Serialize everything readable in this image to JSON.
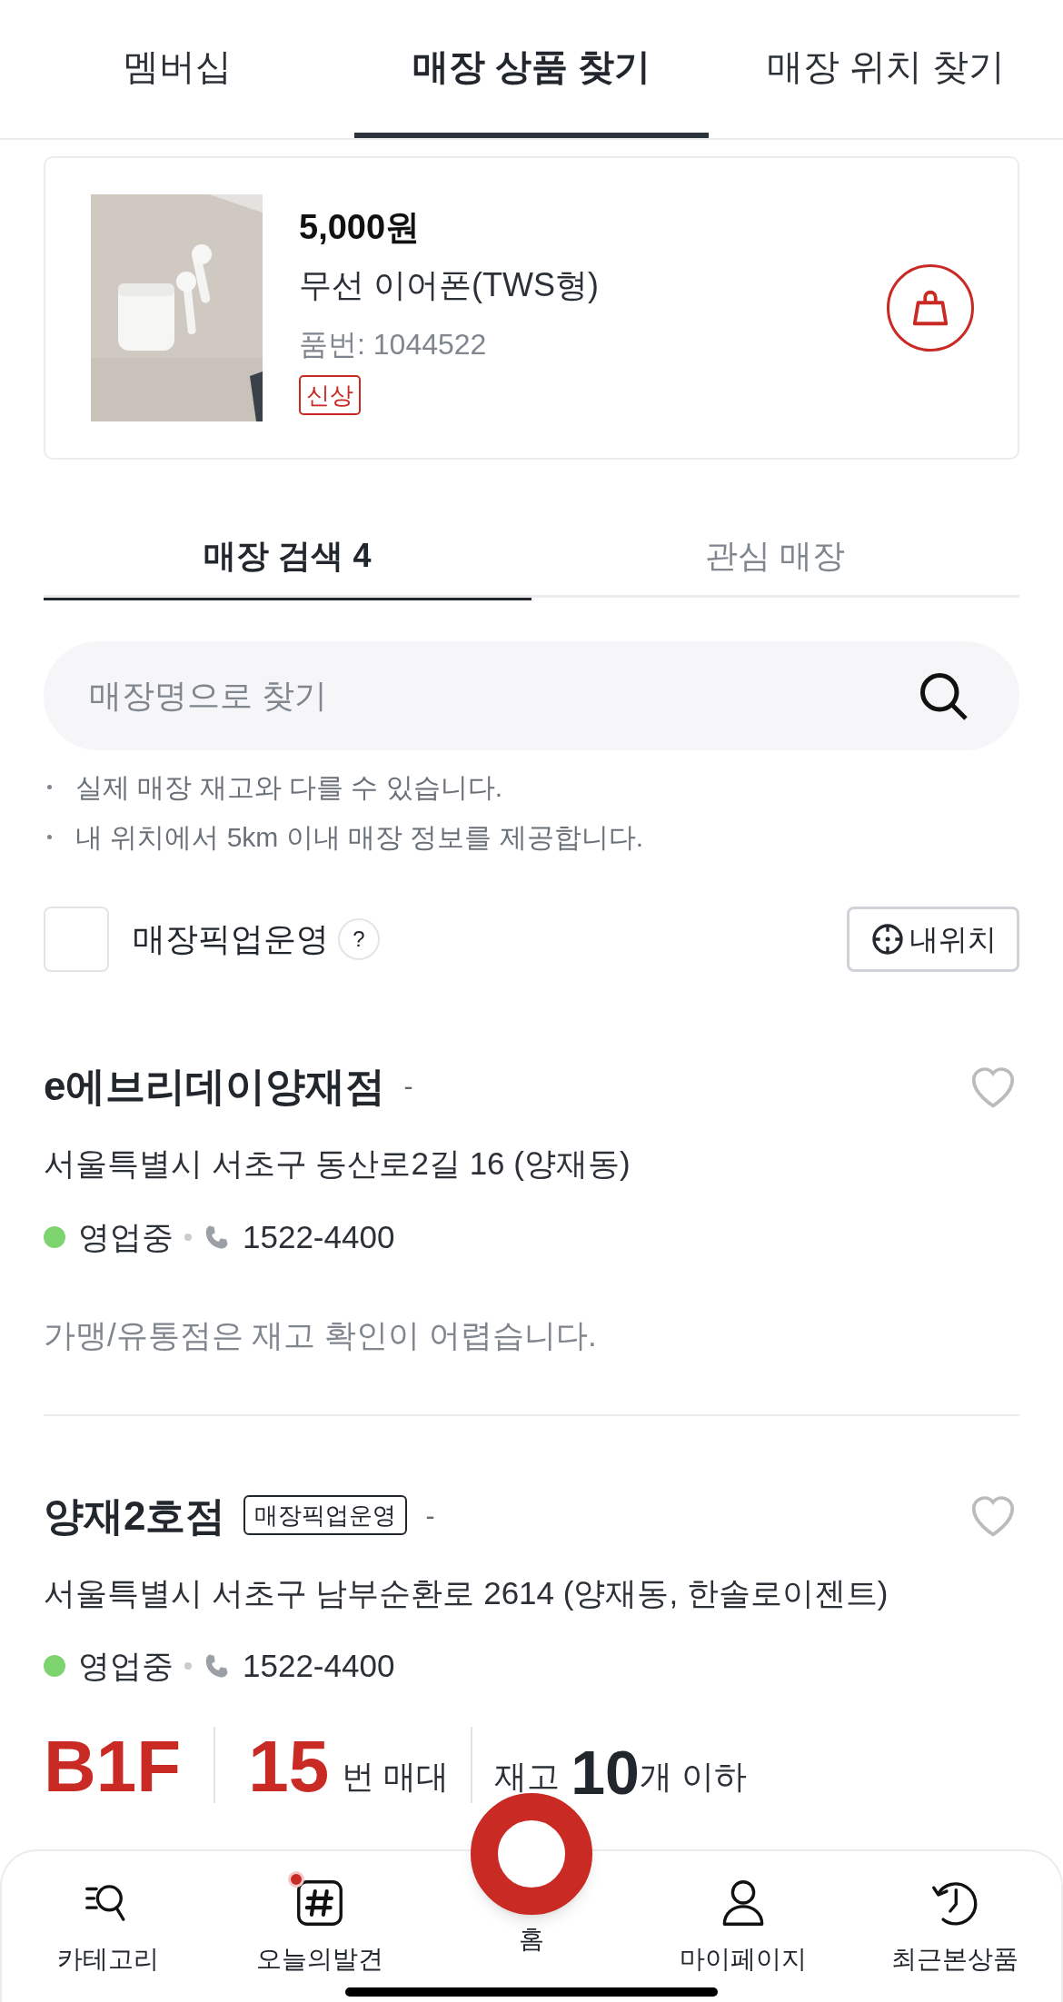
{
  "top_tabs": [
    {
      "label": "멤버십",
      "selected": false
    },
    {
      "label": "매장 상품 찾기",
      "selected": true
    },
    {
      "label": "매장 위치 찾기",
      "selected": false
    }
  ],
  "product": {
    "price": "5,000원",
    "name": "무선 이어폰(TWS형)",
    "item_number": "품번: 1044522",
    "badge": "신상"
  },
  "store_tabs": [
    {
      "label": "매장 검색 4",
      "selected": true
    },
    {
      "label": "관심 매장",
      "selected": false
    }
  ],
  "search": {
    "placeholder": "매장명으로 찾기"
  },
  "notes": [
    "실제 매장 재고와 다를 수 있습니다.",
    "내 위치에서 5km 이내 매장 정보를 제공합니다."
  ],
  "pickup_filter": {
    "label": "매장픽업운영",
    "checked": false,
    "help": "?"
  },
  "my_location_button": "내위치",
  "stores": [
    {
      "kind": "note",
      "name": "e에브리데이양재점",
      "dash": "-",
      "favorite": false,
      "address": "서울특별시 서초구 동산로2길 16 (양재동)",
      "status": "영업중",
      "color": "#7ed56f",
      "phone": "1522-4400",
      "note": "가맹/유통점은 재고 확인이 어렵습니다."
    },
    {
      "kind": "location",
      "name": "양재2호점",
      "badge": "매장픽업운영",
      "dash": "-",
      "favorite": false,
      "address": "서울특별시 서초구 남부순환로 2614 (양재동, 한솔로이젠트)",
      "status": "영업중",
      "color": "#7ed56f",
      "phone": "1522-4400",
      "floor": "B1F",
      "stand": "15",
      "stand_label": "번 매대",
      "stock_label": "재고",
      "stock": "10",
      "stock_suffix": "개 이하"
    }
  ],
  "bottom_nav": [
    {
      "kind": "category",
      "label": "카테고리",
      "new": false
    },
    {
      "kind": "discover",
      "label": "오늘의발견",
      "new": true
    },
    {
      "kind": "home",
      "label": "홈",
      "new": false
    },
    {
      "kind": "mypage",
      "label": "마이페이지",
      "new": false
    },
    {
      "kind": "recent",
      "label": "최근본상품",
      "new": false
    }
  ]
}
